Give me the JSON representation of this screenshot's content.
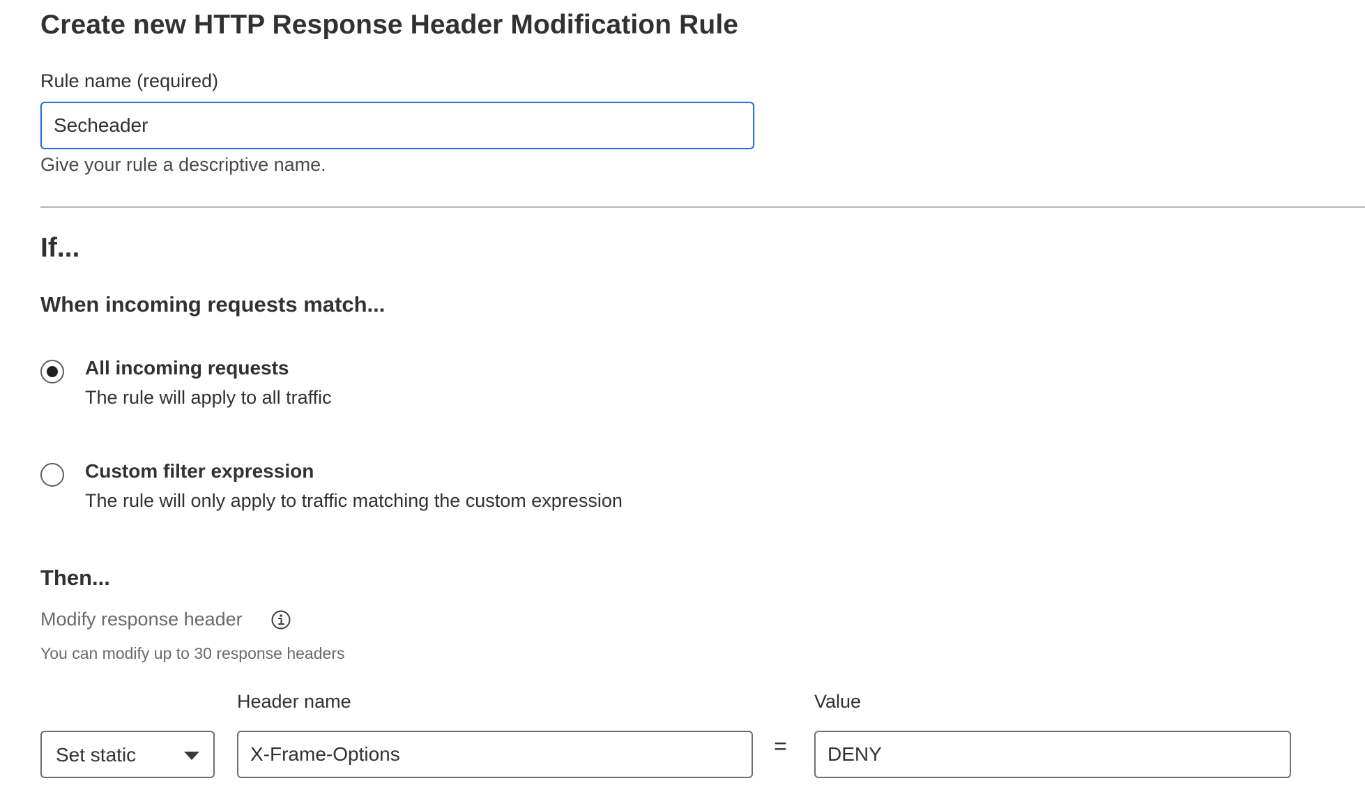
{
  "page": {
    "title": "Create new HTTP Response Header Modification Rule"
  },
  "rule_name": {
    "label": "Rule name (required)",
    "value": "Secheader",
    "hint": "Give your rule a descriptive name."
  },
  "if_section": {
    "heading": "If...",
    "subheading": "When incoming requests match...",
    "options": [
      {
        "title": "All incoming requests",
        "description": "The rule will apply to all traffic",
        "selected": true
      },
      {
        "title": "Custom filter expression",
        "description": "The rule will only apply to traffic matching the custom expression",
        "selected": false
      }
    ]
  },
  "then_section": {
    "heading": "Then...",
    "modify_label": "Modify response header",
    "info_icon": "info-icon",
    "modify_hint": "You can modify up to 30 response headers",
    "operation": {
      "selected": "Set static"
    },
    "header_name": {
      "label": "Header name",
      "value": "X-Frame-Options"
    },
    "equals": "=",
    "header_value": {
      "label": "Value",
      "value": "DENY"
    }
  },
  "colors": {
    "focus_border": "#2c6fd6",
    "text": "#313131",
    "muted_text": "#6a6a6a",
    "divider": "#b4b4b4"
  }
}
